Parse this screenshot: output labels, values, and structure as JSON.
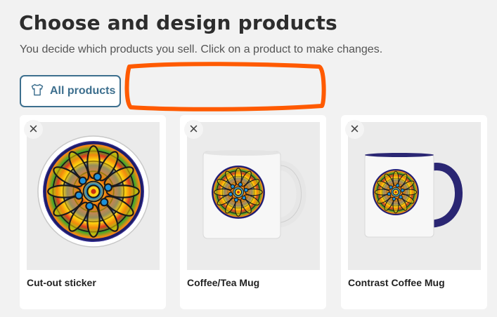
{
  "page": {
    "title": "Choose and design products",
    "subtitle": "You decide which products you sell. Click on a product to make changes."
  },
  "filters": {
    "all_products_label": "All products",
    "icon": "tshirt-icon"
  },
  "colors": {
    "accent": "#3d6f8e",
    "annotation": "#ff5a00",
    "mug_accent": "#2a2673"
  },
  "products": [
    {
      "name": "Cut-out sticker",
      "remove_icon": "close-icon"
    },
    {
      "name": "Coffee/Tea Mug",
      "remove_icon": "close-icon"
    },
    {
      "name": "Contrast Coffee Mug",
      "remove_icon": "close-icon"
    }
  ]
}
